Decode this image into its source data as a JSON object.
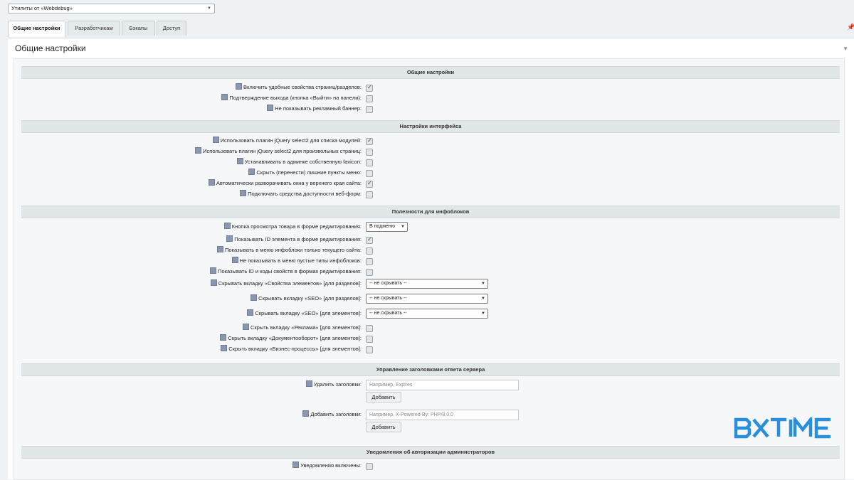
{
  "top_select": {
    "value": "Утилиты от «Webdebug»"
  },
  "tabs": [
    {
      "label": "Общие настройки"
    },
    {
      "label": "Разработчикам"
    },
    {
      "label": "Бэкапы"
    },
    {
      "label": "Доступ"
    }
  ],
  "panel": {
    "title": "Общие настройки"
  },
  "sections": [
    {
      "title": "Общие настройки",
      "rows": [
        {
          "label": "Включить удобные свойства страниц/разделов:",
          "type": "checkbox",
          "checked": true
        },
        {
          "label": "Подтверждение выхода (кнопка «Выйти» на панели):",
          "type": "checkbox",
          "checked": false
        },
        {
          "label": "Не показывать рекламный баннер:",
          "type": "checkbox",
          "checked": false
        }
      ]
    },
    {
      "title": "Настройки интерфейса",
      "rows": [
        {
          "label": "Использовать плагин jQuery select2 для списка модулей:",
          "type": "checkbox",
          "checked": true
        },
        {
          "label": "Использовать плагин jQuery select2 для произвольных страниц:",
          "type": "checkbox",
          "checked": false
        },
        {
          "label": "Устанавливать в админке собственную favicon:",
          "type": "checkbox",
          "checked": false
        },
        {
          "label": "Скрыть (перенести) лишние пункты меню:",
          "type": "checkbox",
          "checked": false
        },
        {
          "label": "Автоматически разворачивать окна у верхнего края сайта:",
          "type": "checkbox",
          "checked": true
        },
        {
          "label": "Подключать средства доступности веб-форм:",
          "type": "checkbox",
          "checked": false
        }
      ]
    },
    {
      "title": "Полезности для инфоблоков",
      "rows": [
        {
          "label": "Кнопка просмотра товара в форме редактирования:",
          "type": "select",
          "value": "В подменю"
        },
        {
          "label": "Показывать ID элемента в форме редактирования:",
          "type": "checkbox",
          "checked": true
        },
        {
          "label": "Показывать в меню инфоблоки только текущего сайта:",
          "type": "checkbox",
          "checked": false
        },
        {
          "label": "Не показывать в меню пустые типы инфоблоков:",
          "type": "checkbox",
          "checked": false
        },
        {
          "label": "Показывать ID и коды свойств в формах редактирования:",
          "type": "checkbox",
          "checked": false
        },
        {
          "label": "Скрывать вкладку «Свойства элементов» [для разделов]:",
          "type": "select",
          "value": "-- не скрывать --"
        },
        {
          "label": "Скрывать вкладку «SEO» [для разделов]:",
          "type": "select",
          "value": "-- не скрывать --"
        },
        {
          "label": "Скрывать вкладку «SEO» [для элементов]:",
          "type": "select",
          "value": "-- не скрывать --"
        },
        {
          "label": "Скрыть вкладку «Реклама» [для элементов]:",
          "type": "checkbox",
          "checked": false
        },
        {
          "label": "Скрыть вкладку «Документооборот» [для элементов]:",
          "type": "checkbox",
          "checked": false
        },
        {
          "label": "Скрыть вкладку «Бизнес-процессы» [для элементов]:",
          "type": "checkbox",
          "checked": false
        }
      ]
    },
    {
      "title": "Управление заголовками ответа сервера",
      "rows": [
        {
          "label": "Удалить заголовки:",
          "type": "text",
          "placeholder": "Например, Expires",
          "button": "Добавить"
        },
        {
          "label": "Добавить заголовки:",
          "type": "text",
          "placeholder": "Например, X-Powered-By: PHP/8.0.0",
          "button": "Добавить"
        }
      ]
    },
    {
      "title": "Уведомления об авторизации администраторов",
      "rows": [
        {
          "label": "Уведомления включены:",
          "type": "checkbox",
          "checked": false
        }
      ]
    }
  ],
  "watermark": {
    "text": "BXTIME",
    "color": "#2a8fdb"
  }
}
